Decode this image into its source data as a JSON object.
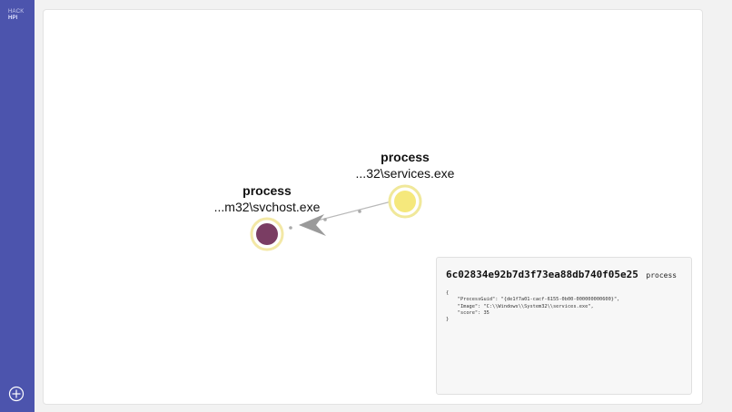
{
  "app": {
    "logo_line1": "HACK",
    "logo_line2": "HPI",
    "accent_color": "#4c54ad"
  },
  "sidebar": {
    "add_button_icon": "plus-circle-icon"
  },
  "graph": {
    "nodes": [
      {
        "id": "services",
        "title": "process",
        "label": "...32\\services.exe",
        "fill_color": "#f5e87c",
        "ring_color": "#f0e89a"
      },
      {
        "id": "svchost",
        "title": "process",
        "label": "...m32\\svchost.exe",
        "fill_color": "#7a3d63",
        "ring_color": "#f3e8a6"
      }
    ],
    "edges": [
      {
        "from": "services",
        "to": "svchost",
        "color": "#b9b9b9"
      }
    ]
  },
  "detail": {
    "id": "6c02834e92b7d3f73ea88db740f05e25",
    "type": "process",
    "json_text": "{\n    \"ProcessGuid\": \"{de1f7a01-cacf-6155-0b00-000000000600}\",\n    \"Image\": \"C:\\\\Windows\\\\System32\\\\services.exe\",\n    \"score\": 35\n}"
  }
}
